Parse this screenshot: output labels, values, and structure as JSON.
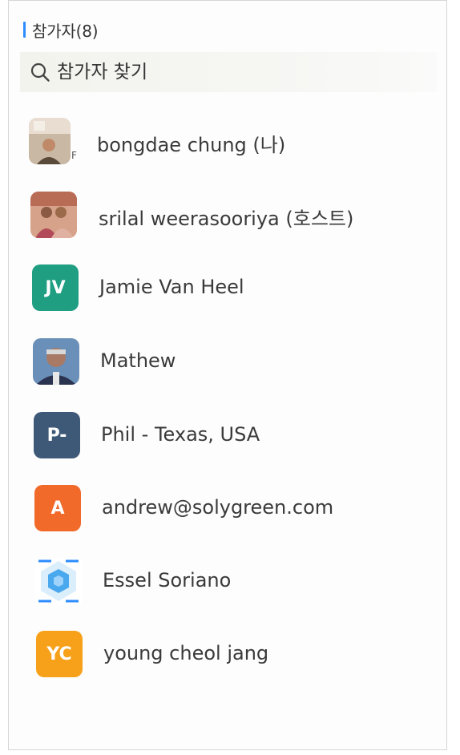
{
  "header": {
    "title": "참가자(8)",
    "accent_color": "#2d8cff"
  },
  "search": {
    "placeholder": "참가자 찾기",
    "icon": "search-icon"
  },
  "participants": [
    {
      "name": "bongdae chung (나)",
      "avatar_type": "photo",
      "avatar_icon": "user-photo-icon"
    },
    {
      "name": "srilal weerasooriya (호스트)",
      "avatar_type": "photo",
      "avatar_icon": "user-photo-icon"
    },
    {
      "name": "Jamie Van Heel",
      "avatar_type": "initials",
      "initials": "JV",
      "color": "#1f9e82"
    },
    {
      "name": "Mathew",
      "avatar_type": "photo",
      "avatar_icon": "user-photo-icon"
    },
    {
      "name": "Phil - Texas, USA",
      "avatar_type": "initials",
      "initials": "P-",
      "color": "#3e5978"
    },
    {
      "name": "andrew@solygreen.com",
      "avatar_type": "initials",
      "initials": "A",
      "color": "#f26a2a"
    },
    {
      "name": "Essel Soriano",
      "avatar_type": "photo",
      "avatar_icon": "hexagon-logo-icon"
    },
    {
      "name": "young cheol jang",
      "avatar_type": "initials",
      "initials": "YC",
      "color": "#f7a11b"
    }
  ],
  "colors": {
    "text": "#3a3a3a",
    "panel_border": "#d6d6d6"
  }
}
